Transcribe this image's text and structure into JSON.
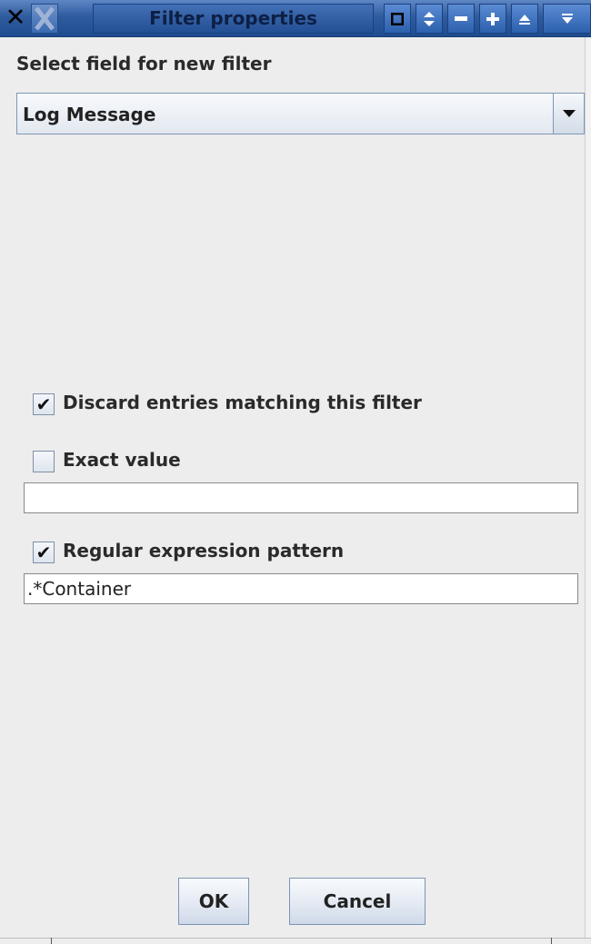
{
  "window": {
    "title": "Filter properties",
    "buttons": [
      "close-icon",
      "app-icon",
      "restore-icon",
      "shade-icon",
      "minimize-icon",
      "maximize-icon",
      "raise-icon",
      "lower-icon"
    ]
  },
  "form": {
    "field_label": "Select field for new filter",
    "field_selected": "Log Message",
    "discard": {
      "label": "Discard entries matching this filter",
      "checked": true
    },
    "exact": {
      "label": "Exact value",
      "checked": false,
      "value": ""
    },
    "regex": {
      "label": "Regular expression pattern",
      "checked": true,
      "value": ".*Container"
    }
  },
  "actions": {
    "ok_label": "OK",
    "cancel_label": "Cancel"
  },
  "colors": {
    "titlebar": "#2f5c9f",
    "background": "#ededed"
  }
}
